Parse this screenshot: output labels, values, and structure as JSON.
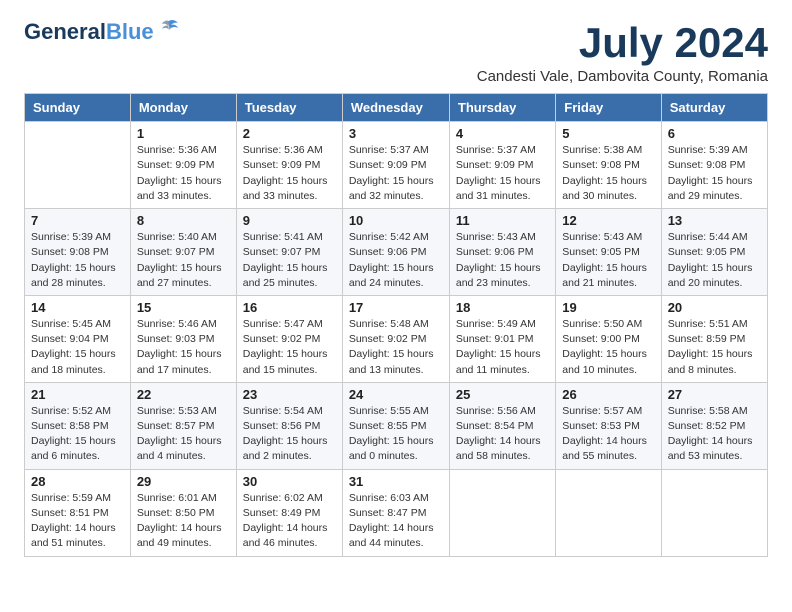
{
  "logo": {
    "line1": "General",
    "line2": "Blue"
  },
  "title": "July 2024",
  "subtitle": "Candesti Vale, Dambovita County, Romania",
  "headers": [
    "Sunday",
    "Monday",
    "Tuesday",
    "Wednesday",
    "Thursday",
    "Friday",
    "Saturday"
  ],
  "weeks": [
    [
      {
        "day": "",
        "info": ""
      },
      {
        "day": "1",
        "info": "Sunrise: 5:36 AM\nSunset: 9:09 PM\nDaylight: 15 hours\nand 33 minutes."
      },
      {
        "day": "2",
        "info": "Sunrise: 5:36 AM\nSunset: 9:09 PM\nDaylight: 15 hours\nand 33 minutes."
      },
      {
        "day": "3",
        "info": "Sunrise: 5:37 AM\nSunset: 9:09 PM\nDaylight: 15 hours\nand 32 minutes."
      },
      {
        "day": "4",
        "info": "Sunrise: 5:37 AM\nSunset: 9:09 PM\nDaylight: 15 hours\nand 31 minutes."
      },
      {
        "day": "5",
        "info": "Sunrise: 5:38 AM\nSunset: 9:08 PM\nDaylight: 15 hours\nand 30 minutes."
      },
      {
        "day": "6",
        "info": "Sunrise: 5:39 AM\nSunset: 9:08 PM\nDaylight: 15 hours\nand 29 minutes."
      }
    ],
    [
      {
        "day": "7",
        "info": "Sunrise: 5:39 AM\nSunset: 9:08 PM\nDaylight: 15 hours\nand 28 minutes."
      },
      {
        "day": "8",
        "info": "Sunrise: 5:40 AM\nSunset: 9:07 PM\nDaylight: 15 hours\nand 27 minutes."
      },
      {
        "day": "9",
        "info": "Sunrise: 5:41 AM\nSunset: 9:07 PM\nDaylight: 15 hours\nand 25 minutes."
      },
      {
        "day": "10",
        "info": "Sunrise: 5:42 AM\nSunset: 9:06 PM\nDaylight: 15 hours\nand 24 minutes."
      },
      {
        "day": "11",
        "info": "Sunrise: 5:43 AM\nSunset: 9:06 PM\nDaylight: 15 hours\nand 23 minutes."
      },
      {
        "day": "12",
        "info": "Sunrise: 5:43 AM\nSunset: 9:05 PM\nDaylight: 15 hours\nand 21 minutes."
      },
      {
        "day": "13",
        "info": "Sunrise: 5:44 AM\nSunset: 9:05 PM\nDaylight: 15 hours\nand 20 minutes."
      }
    ],
    [
      {
        "day": "14",
        "info": "Sunrise: 5:45 AM\nSunset: 9:04 PM\nDaylight: 15 hours\nand 18 minutes."
      },
      {
        "day": "15",
        "info": "Sunrise: 5:46 AM\nSunset: 9:03 PM\nDaylight: 15 hours\nand 17 minutes."
      },
      {
        "day": "16",
        "info": "Sunrise: 5:47 AM\nSunset: 9:02 PM\nDaylight: 15 hours\nand 15 minutes."
      },
      {
        "day": "17",
        "info": "Sunrise: 5:48 AM\nSunset: 9:02 PM\nDaylight: 15 hours\nand 13 minutes."
      },
      {
        "day": "18",
        "info": "Sunrise: 5:49 AM\nSunset: 9:01 PM\nDaylight: 15 hours\nand 11 minutes."
      },
      {
        "day": "19",
        "info": "Sunrise: 5:50 AM\nSunset: 9:00 PM\nDaylight: 15 hours\nand 10 minutes."
      },
      {
        "day": "20",
        "info": "Sunrise: 5:51 AM\nSunset: 8:59 PM\nDaylight: 15 hours\nand 8 minutes."
      }
    ],
    [
      {
        "day": "21",
        "info": "Sunrise: 5:52 AM\nSunset: 8:58 PM\nDaylight: 15 hours\nand 6 minutes."
      },
      {
        "day": "22",
        "info": "Sunrise: 5:53 AM\nSunset: 8:57 PM\nDaylight: 15 hours\nand 4 minutes."
      },
      {
        "day": "23",
        "info": "Sunrise: 5:54 AM\nSunset: 8:56 PM\nDaylight: 15 hours\nand 2 minutes."
      },
      {
        "day": "24",
        "info": "Sunrise: 5:55 AM\nSunset: 8:55 PM\nDaylight: 15 hours\nand 0 minutes."
      },
      {
        "day": "25",
        "info": "Sunrise: 5:56 AM\nSunset: 8:54 PM\nDaylight: 14 hours\nand 58 minutes."
      },
      {
        "day": "26",
        "info": "Sunrise: 5:57 AM\nSunset: 8:53 PM\nDaylight: 14 hours\nand 55 minutes."
      },
      {
        "day": "27",
        "info": "Sunrise: 5:58 AM\nSunset: 8:52 PM\nDaylight: 14 hours\nand 53 minutes."
      }
    ],
    [
      {
        "day": "28",
        "info": "Sunrise: 5:59 AM\nSunset: 8:51 PM\nDaylight: 14 hours\nand 51 minutes."
      },
      {
        "day": "29",
        "info": "Sunrise: 6:01 AM\nSunset: 8:50 PM\nDaylight: 14 hours\nand 49 minutes."
      },
      {
        "day": "30",
        "info": "Sunrise: 6:02 AM\nSunset: 8:49 PM\nDaylight: 14 hours\nand 46 minutes."
      },
      {
        "day": "31",
        "info": "Sunrise: 6:03 AM\nSunset: 8:47 PM\nDaylight: 14 hours\nand 44 minutes."
      },
      {
        "day": "",
        "info": ""
      },
      {
        "day": "",
        "info": ""
      },
      {
        "day": "",
        "info": ""
      }
    ]
  ]
}
